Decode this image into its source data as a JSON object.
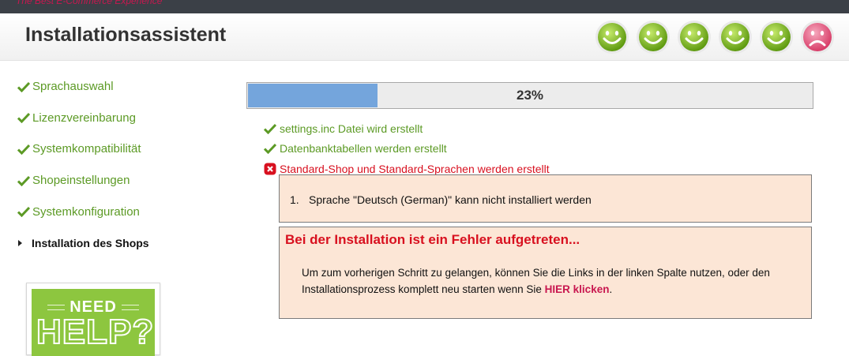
{
  "brand": {
    "tagline": "The Best E-Commerce Experience",
    "accent": "#c8174f"
  },
  "header": {
    "title": "Installationsassistent"
  },
  "smileys": [
    "smiley-happy-icon",
    "smiley-happy-icon",
    "smiley-happy-icon",
    "smiley-happy-icon",
    "smiley-happy-icon",
    "smiley-sad-icon"
  ],
  "sidebar": {
    "items": [
      {
        "label": "Sprachauswahl",
        "state": "done"
      },
      {
        "label": "Lizenzvereinbarung",
        "state": "done"
      },
      {
        "label": "Systemkompatibilität",
        "state": "done"
      },
      {
        "label": "Shopeinstellungen",
        "state": "done"
      },
      {
        "label": "Systemkonfiguration",
        "state": "done"
      },
      {
        "label": "Installation des Shops",
        "state": "current"
      }
    ],
    "help_banner": {
      "line1": "NEED",
      "line2": "HELP?"
    }
  },
  "progress": {
    "percent_label": "23%",
    "value": 0.23,
    "fill_color": "#74a5dc"
  },
  "steps": [
    {
      "label": "settings.inc Datei wird erstellt",
      "status": "ok"
    },
    {
      "label": "Datenbanktabellen werden erstellt",
      "status": "ok"
    },
    {
      "label": "Standard-Shop und Standard-Sprachen werden erstellt",
      "status": "error"
    }
  ],
  "errors": [
    {
      "number": "1.",
      "text": "Sprache \"Deutsch (German)\" kann nicht installiert werden"
    }
  ],
  "failure": {
    "title": "Bei der Installation ist ein Fehler aufgetreten...",
    "text_before": "Um zum vorherigen Schritt zu gelangen, können Sie die Links in der linken Spalte nutzen, oder den Installationsprozess komplett neu starten wenn Sie ",
    "link_label": "HIER klicken",
    "text_after": "."
  },
  "colors": {
    "ok": "#5c9a25",
    "error": "#d8101f",
    "error_bg": "#fce6d6"
  }
}
